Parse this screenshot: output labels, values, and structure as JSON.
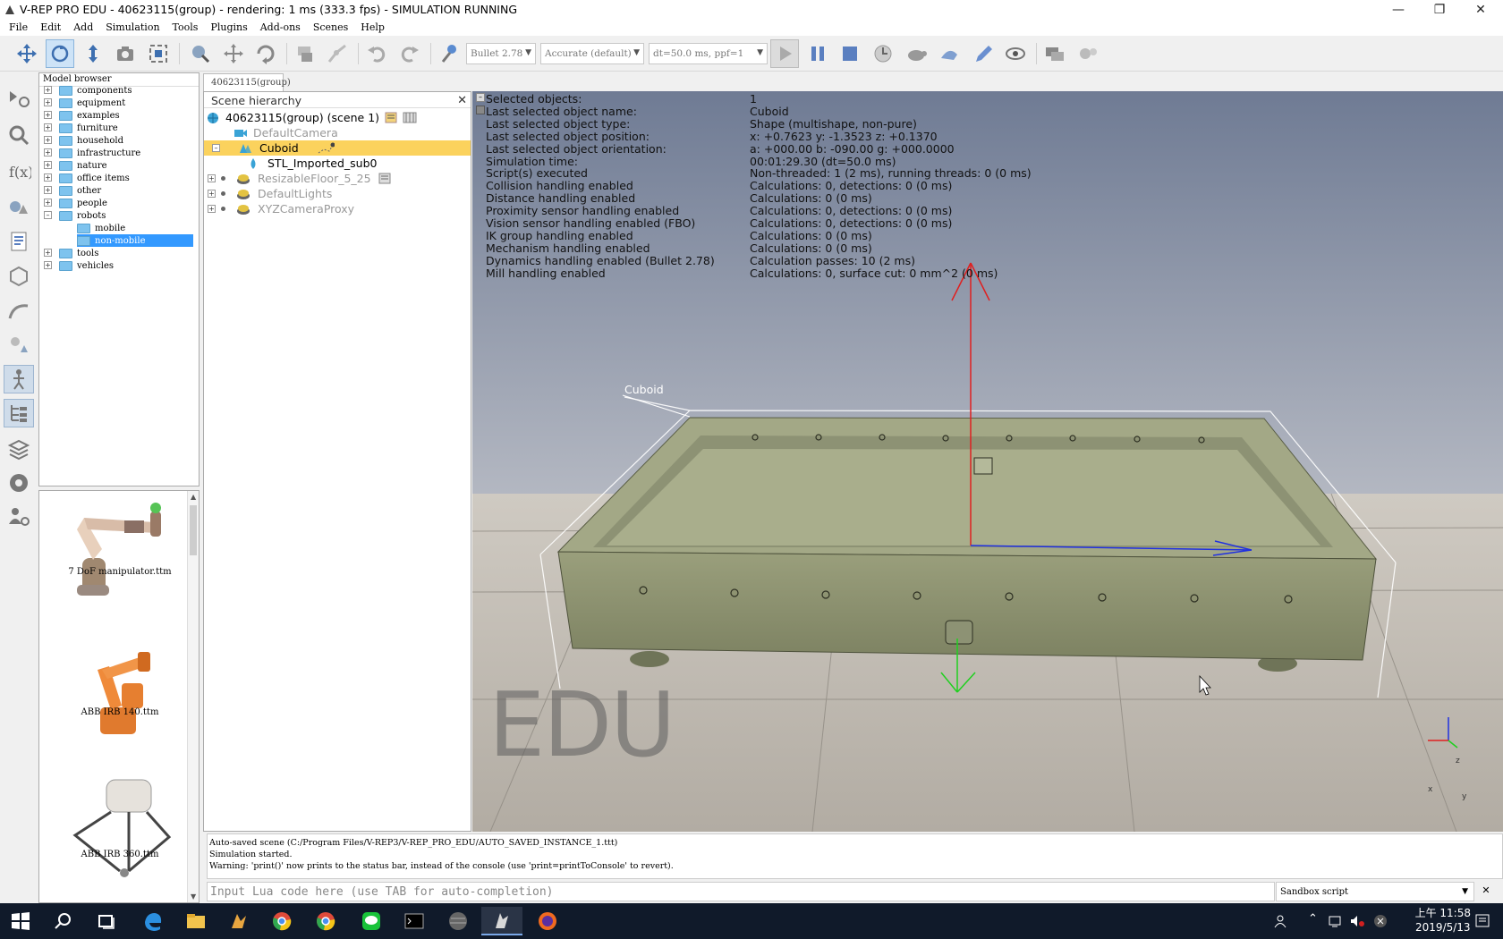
{
  "window": {
    "title": "V-REP PRO EDU - 40623115(group) - rendering: 1 ms (333.3 fps) - SIMULATION RUNNING"
  },
  "menu": [
    "File",
    "Edit",
    "Add",
    "Simulation",
    "Tools",
    "Plugins",
    "Add-ons",
    "Scenes",
    "Help"
  ],
  "toolbar": {
    "engine": "Bullet 2.78",
    "accuracy": "Accurate (default)",
    "timestep": "dt=50.0 ms, ppf=1"
  },
  "model_browser": {
    "title": "Model browser",
    "folders": [
      "components",
      "equipment",
      "examples",
      "furniture",
      "household",
      "infrastructure",
      "nature",
      "office items",
      "other",
      "people",
      "robots",
      "mobile",
      "non-mobile",
      "tools",
      "vehicles"
    ],
    "selected": "non-mobile",
    "thumbs": [
      "7 DoF manipulator.ttm",
      "ABB IRB 140.ttm",
      "ABB IRB 360.ttm"
    ]
  },
  "scene_tab": "40623115(group)",
  "scene_hierarchy": {
    "title": "Scene hierarchy",
    "root": "40623115(group) (scene 1)",
    "items": [
      "DefaultCamera",
      "Cuboid",
      "STL_Imported_sub0",
      "ResizableFloor_5_25",
      "DefaultLights",
      "XYZCameraProxy"
    ]
  },
  "info": [
    {
      "label": "Selected objects:",
      "value": "1"
    },
    {
      "label": "Last selected object name:",
      "value": "Cuboid"
    },
    {
      "label": "Last selected object type:",
      "value": "Shape (multishape, non-pure)"
    },
    {
      "label": "Last selected object position:",
      "value": "x: +0.7623    y: -1.3523    z: +0.1370"
    },
    {
      "label": "Last selected object orientation:",
      "value": "a: +000.00    b: -090.00    g: +000.0000"
    },
    {
      "label": "Simulation time:",
      "value": "00:01:29.30 (dt=50.0 ms)"
    },
    {
      "label": "Script(s) executed",
      "value": "Non-threaded: 1 (2 ms), running threads: 0 (0 ms)"
    },
    {
      "label": "Collision handling enabled",
      "value": "Calculations: 0, detections: 0 (0 ms)"
    },
    {
      "label": "Distance handling enabled",
      "value": "Calculations: 0 (0 ms)"
    },
    {
      "label": "Proximity sensor handling enabled",
      "value": "Calculations: 0, detections: 0 (0 ms)"
    },
    {
      "label": "Vision sensor handling enabled (FBO)",
      "value": "Calculations: 0, detections: 0 (0 ms)"
    },
    {
      "label": "IK group handling enabled",
      "value": "Calculations: 0 (0 ms)"
    },
    {
      "label": "Mechanism handling enabled",
      "value": "Calculations: 0 (0 ms)"
    },
    {
      "label": "Dynamics handling enabled (Bullet 2.78)",
      "value": "Calculation passes: 10 (2 ms)"
    },
    {
      "label": "Mill handling enabled",
      "value": "Calculations: 0, surface cut: 0 mm^2 (0 ms)"
    }
  ],
  "viewport": {
    "object_label": "Cuboid",
    "watermark": "EDU",
    "axis_z": "z",
    "axis_y": "y",
    "axis_x": "x"
  },
  "console": [
    "Auto-saved scene (C:/Program Files/V-REP3/V-REP_PRO_EDU/AUTO_SAVED_INSTANCE_1.ttt)",
    "Simulation started.",
    "Warning: 'print()' now prints to the status bar, instead of the console (use 'print=printToConsole' to revert)."
  ],
  "lua_input": {
    "placeholder": "Input Lua code here (use TAB for auto-completion)"
  },
  "script_selector": "Sandbox script",
  "clock": {
    "time": "上午 11:58",
    "date": "2019/5/13"
  },
  "colors": {
    "selection": "#fbd25d",
    "tray": "#8a8f6c",
    "floor": "#b8b2a8",
    "sky_top": "#6f7b94",
    "sky_bottom": "#d7d9dd"
  }
}
